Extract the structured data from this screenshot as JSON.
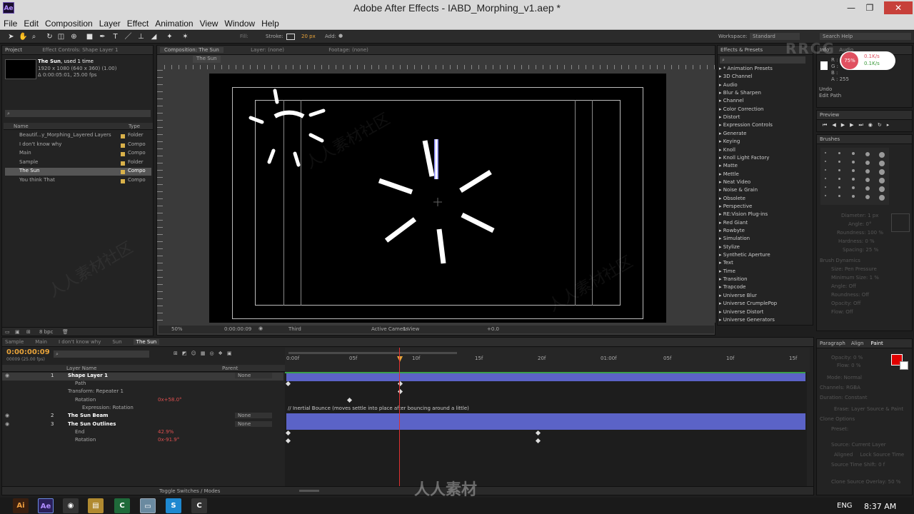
{
  "window": {
    "title": "Adobe After Effects - IABD_Morphing_v1.aep *",
    "app_icon": "Ae"
  },
  "menu": [
    "File",
    "Edit",
    "Composition",
    "Layer",
    "Effect",
    "Animation",
    "View",
    "Window",
    "Help"
  ],
  "toolbar": {
    "fill_label": "Fill:",
    "stroke_label": "Stroke:",
    "stroke_size": "20 px",
    "add_label": "Add:",
    "workspace_label": "Workspace:",
    "workspace": "Standard",
    "search_placeholder": "Search Help"
  },
  "project": {
    "tab": "Project",
    "effect_tab": "Effect Controls: Shape Layer 1",
    "item_name": "The Sun",
    "item_used": ", used 1 time",
    "item_size": "1920 x 1080  (640 x 360) (1.00)",
    "item_duration": "Δ 0:00:05:01, 25.00 fps",
    "col_name": "Name",
    "col_type": "Type",
    "items": [
      {
        "name": "Beautif...y_Morphing_Layered Layers",
        "type": "Folder",
        "color": "#d9b14a"
      },
      {
        "name": "I don't know why",
        "type": "Compo",
        "color": "#d9b14a"
      },
      {
        "name": "Main",
        "type": "Compo",
        "color": "#d9b14a"
      },
      {
        "name": "Sample",
        "type": "Folder",
        "color": "#d9b14a"
      },
      {
        "name": "The Sun",
        "type": "Compo",
        "color": "#d9b14a"
      },
      {
        "name": "You think That",
        "type": "Compo",
        "color": "#d9b14a"
      }
    ],
    "bpc": "8 bpc"
  },
  "composition": {
    "tab": "Composition: The Sun",
    "layer_tab": "Layer: (none)",
    "footage_tab": "Footage: (none)",
    "sub_tab": "The Sun",
    "zoom": "50%",
    "timecode": "0:00:00:09",
    "resolution": "Third",
    "camera": "Active Camera",
    "views": "1 View",
    "exposure": "+0.0"
  },
  "effects": {
    "tab": "Effects & Presets",
    "items": [
      "* Animation Presets",
      "3D Channel",
      "Audio",
      "Blur & Sharpen",
      "Channel",
      "Color Correction",
      "Distort",
      "Expression Controls",
      "Generate",
      "Keying",
      "Knoll",
      "Knoll Light Factory",
      "Matte",
      "Mettle",
      "Neat Video",
      "Noise & Grain",
      "Obsolete",
      "Perspective",
      "RE:Vision Plug-ins",
      "Red Giant",
      "Rowbyte",
      "Simulation",
      "Stylize",
      "Synthetic Aperture",
      "Text",
      "Time",
      "Transition",
      "Trapcode",
      "Universe Blur",
      "Universe CrumplePop",
      "Universe Distort",
      "Universe Generators"
    ]
  },
  "info": {
    "tab": "Info",
    "tab2": "Audio",
    "r": "R :",
    "g": "G :",
    "b": "B :",
    "a": "A : 255",
    "undo": "Undo",
    "undo_action": "Edit Path",
    "net_up": "0.1K/s",
    "net_down": "0.1K/s",
    "cpu": "75%"
  },
  "preview": {
    "tab": "Preview"
  },
  "brushes": {
    "tab": "Brushes",
    "diameter": "Diameter: 1 px",
    "angle": "Angle: 0°",
    "roundness": "Roundness: 100 %",
    "hardness": "Hardness: 0 %",
    "spacing": "Spacing: 25 %",
    "dynamics": "Brush Dynamics",
    "size": "Size:",
    "size_val": "Pen Pressure",
    "min_size": "Minimum Size: 1 %",
    "angle2": "Angle:",
    "angle2_val": "Off",
    "roundness2": "Roundness:",
    "roundness2_val": "Off",
    "opacity": "Opacity:",
    "opacity_val": "Off",
    "flow": "Flow:",
    "flow_val": "Off"
  },
  "paint": {
    "tab1": "Paragraph",
    "tab2": "Align",
    "tab3": "Paint",
    "opacity": "Opacity: 0 %",
    "flow": "Flow: 0 %",
    "mode": "Mode:",
    "mode_val": "Normal",
    "channels": "Channels:",
    "channels_val": "RGBA",
    "duration": "Duration:",
    "duration_val": "Constant",
    "erase": "Erase:",
    "erase_val": "Layer Source & Paint",
    "clone_options": "Clone Options",
    "preset": "Preset:",
    "source": "Source:",
    "source_val": "Current Layer",
    "aligned": "Aligned",
    "lock_source": "Lock Source Time",
    "source_time_shift": "Source Time Shift: 0 f",
    "clone_overlay": "Clone Source Overlay: 50 %"
  },
  "timeline": {
    "tabs": [
      "Sample",
      "Main",
      "I don't know why",
      "Sun",
      "The Sun"
    ],
    "timecode": "0:00:00:09",
    "frame_info": "00009 (25.00 fps)",
    "col_layer": "Layer Name",
    "col_parent": "Parent",
    "ruler": [
      "0:00f",
      "05f",
      "10f",
      "15f",
      "20f",
      "01:00f",
      "05f",
      "10f",
      "15f"
    ],
    "layers": [
      {
        "num": "1",
        "name": "Shape Layer 1",
        "parent": "None"
      },
      {
        "num": "",
        "name": "Path"
      },
      {
        "num": "",
        "name": "Transform: Repeater 1"
      },
      {
        "num": "",
        "name": "Rotation",
        "value": "0x+58.0°"
      },
      {
        "num": "",
        "name": "Expression: Rotation"
      },
      {
        "num": "2",
        "name": "The Sun Beam",
        "parent": "None"
      },
      {
        "num": "3",
        "name": "The Sun Outlines",
        "parent": "None"
      },
      {
        "num": "",
        "name": "End",
        "value": "42.9%"
      },
      {
        "num": "",
        "name": "Rotation",
        "value": "0x-91.9°"
      }
    ],
    "expression": "// Inertial Bounce (moves settle into place after bouncing around a little)",
    "toggle": "Toggle Switches / Modes"
  },
  "taskbar": {
    "lang": "ENG",
    "time": "8:37 AM"
  },
  "watermark": {
    "logo": "RRCG",
    "text": "人人素材社区",
    "bottom": "人人素材"
  }
}
